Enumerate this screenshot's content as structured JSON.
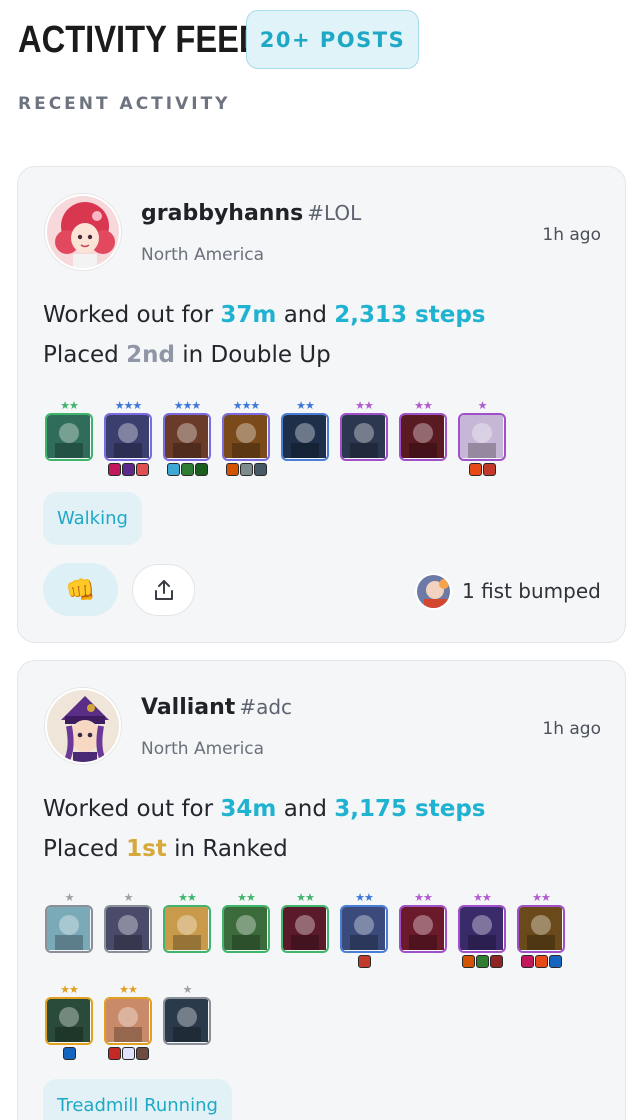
{
  "header": {
    "title": "ACTIVITY FEED",
    "count_badge": "20+ POSTS"
  },
  "section_label": "RECENT ACTIVITY",
  "posts": [
    {
      "username": "grabbyhanns",
      "tag": "#LOL",
      "region": "North America",
      "time": "1h ago",
      "line1": {
        "prefix": "Worked out for ",
        "minutes": "37m",
        "mid": " and ",
        "steps": "2,313 steps"
      },
      "line2": {
        "prefix": "Placed ",
        "place": "2nd",
        "suffix": " in Double Up"
      },
      "activity": "Walking",
      "bump_text": "1 fist bumped",
      "units": [
        {
          "stars": "★★",
          "border": "#3fb46b",
          "items": []
        },
        {
          "stars": "★★★",
          "border": "#7b6be0",
          "items": [
            "#c2185b",
            "#5c2a8a",
            "#e05050"
          ]
        },
        {
          "stars": "★★★",
          "border": "#7b6be0",
          "items": [
            "#3fa7d6",
            "#2e7d32",
            "#1b5e20"
          ]
        },
        {
          "stars": "★★★",
          "border": "#7b6be0",
          "items": [
            "#d35400",
            "#7f8c8d",
            "#455a64"
          ]
        },
        {
          "stars": "★★",
          "border": "#4a7ed6",
          "items": []
        },
        {
          "stars": "★★",
          "border": "#a050c8",
          "items": []
        },
        {
          "stars": "★★",
          "border": "#a050c8",
          "items": []
        },
        {
          "stars": "★",
          "border": "#a050c8",
          "items": [
            "#e64a19",
            "#c0392b"
          ]
        }
      ]
    },
    {
      "username": "Valliant",
      "tag": "#adc",
      "region": "North America",
      "time": "1h ago",
      "line1": {
        "prefix": "Worked out for ",
        "minutes": "34m",
        "mid": " and ",
        "steps": "3,175 steps"
      },
      "line2": {
        "prefix": "Placed ",
        "place": "1st",
        "suffix": " in Ranked"
      },
      "activity": "Treadmill Running",
      "units": [
        {
          "stars": "★",
          "border": "#8a8f98",
          "items": []
        },
        {
          "stars": "★",
          "border": "#8a8f98",
          "items": []
        },
        {
          "stars": "★★",
          "border": "#3fb46b",
          "items": []
        },
        {
          "stars": "★★",
          "border": "#3fb46b",
          "items": []
        },
        {
          "stars": "★★",
          "border": "#3fb46b",
          "items": []
        },
        {
          "stars": "★★",
          "border": "#4a7ed6",
          "items": [
            "#c0392b"
          ]
        },
        {
          "stars": "★★",
          "border": "#a050c8",
          "items": []
        },
        {
          "stars": "★★",
          "border": "#a050c8",
          "items": [
            "#d35400",
            "#2e7d32",
            "#8e2424"
          ]
        },
        {
          "stars": "★★",
          "border": "#a050c8",
          "items": [
            "#c2185b",
            "#e64a19",
            "#1565c0"
          ]
        },
        {
          "stars": "★★",
          "border": "#e0a020",
          "items": [
            "#1565c0"
          ]
        },
        {
          "stars": "★★",
          "border": "#e0a020",
          "items": [
            "#c62828",
            "#e0e0ff",
            "#6d4c41"
          ]
        },
        {
          "stars": "★",
          "border": "#8a8f98",
          "items": []
        }
      ]
    }
  ],
  "colors": {
    "accent": "#1fb2d1",
    "place_second": "#8f96a6",
    "place_first": "#d6a93a",
    "star_gray": "#9aa0a8",
    "star_green": "#3fb46b",
    "star_blue": "#3d78d8",
    "star_purple": "#b05ad0",
    "star_gold": "#e0a020"
  }
}
